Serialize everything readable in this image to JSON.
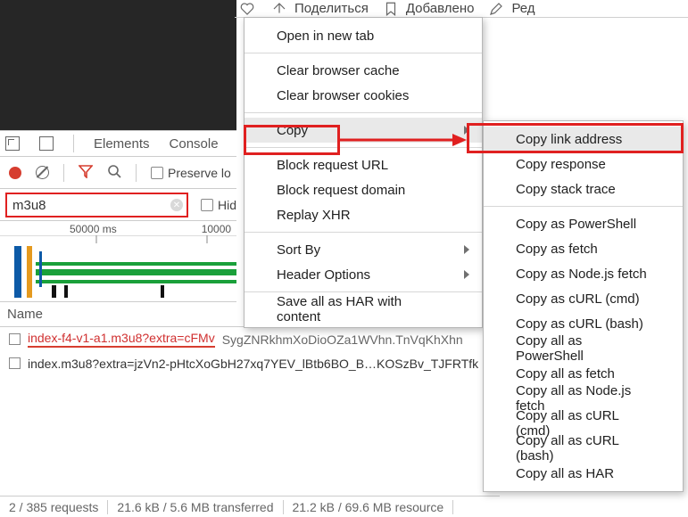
{
  "toolbar": {
    "share": "Поделиться",
    "added": "Добавлено",
    "edit": "Ред"
  },
  "devtools": {
    "tabs": {
      "elements": "Elements",
      "console": "Console"
    },
    "preserve": "Preserve lo",
    "hide": "Hid",
    "filter_value": "m3u8",
    "name_header": "Name",
    "timeline": {
      "t1": "50000 ms",
      "t2": "10000"
    },
    "rows": [
      {
        "main": "index-f4-v1-a1.m3u8?extra=cFMv",
        "tail": "SygZNRkhmXoDioOZa1WVhn.TnVqKhXhn"
      },
      {
        "main": "index.m3u8?extra=jzVn2-pHtcXoGbH27xq7YEV_lBtb6BO_B…KOSzBv_TJFRTfk",
        "tail": ""
      }
    ],
    "status": {
      "requests": "2 / 385 requests",
      "transferred": "21.6 kB / 5.6 MB transferred",
      "resource": "21.2 kB / 69.6 MB resource"
    }
  },
  "menu1": {
    "open_new_tab": "Open in new tab",
    "clear_cache": "Clear browser cache",
    "clear_cookies": "Clear browser cookies",
    "copy": "Copy",
    "block_url": "Block request URL",
    "block_domain": "Block request domain",
    "replay_xhr": "Replay XHR",
    "sort_by": "Sort By",
    "header_options": "Header Options",
    "save_har": "Save all as HAR with content"
  },
  "menu2": {
    "copy_link": "Copy link address",
    "copy_response": "Copy response",
    "copy_stack": "Copy stack trace",
    "as_ps": "Copy as PowerShell",
    "as_fetch": "Copy as fetch",
    "as_node": "Copy as Node.js fetch",
    "as_curl_cmd": "Copy as cURL (cmd)",
    "as_curl_bash": "Copy as cURL (bash)",
    "all_ps": "Copy all as PowerShell",
    "all_fetch": "Copy all as fetch",
    "all_node": "Copy all as Node.js fetch",
    "all_curl_cmd": "Copy all as cURL (cmd)",
    "all_curl_bash": "Copy all as cURL (bash)",
    "all_har": "Copy all as HAR"
  }
}
